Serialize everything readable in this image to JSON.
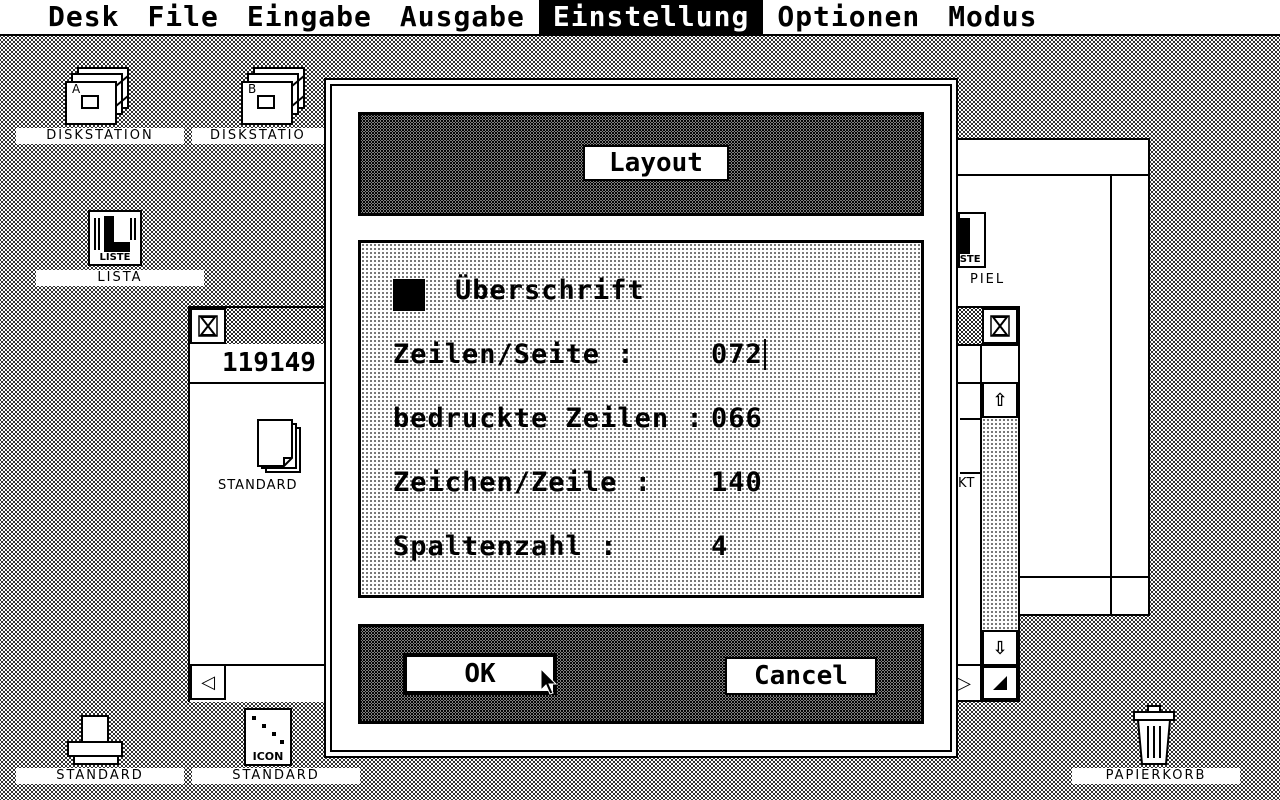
{
  "menubar": {
    "items": [
      {
        "label": "Desk"
      },
      {
        "label": "File"
      },
      {
        "label": "Eingabe"
      },
      {
        "label": "Ausgabe"
      },
      {
        "label": "Einstellung"
      },
      {
        "label": "Optionen"
      },
      {
        "label": "Modus"
      }
    ]
  },
  "desktop": {
    "drive_a_label": "DISKSTATION",
    "drive_b_label": "DISKSTATIO",
    "drive_a_letter": "A",
    "drive_b_letter": "B",
    "lista_label": "LISTA",
    "lista_icon_text": "LISTE",
    "spiel_label": "PIEL",
    "spiel_icon_text": "ISTE",
    "printer_label": "STANDARD",
    "icon_file_label": "STANDARD",
    "icon_file_text": "ICON",
    "trash_label": "PAPIERKORB"
  },
  "left_window": {
    "counter": "119149",
    "file_label": "STANDARD"
  },
  "right_window": {
    "file_label": "KT"
  },
  "dialog": {
    "title": "Layout",
    "checkbox_label": "Überschrift",
    "checkbox_checked": true,
    "rows": [
      {
        "label": "Zeilen/Seite :",
        "value": "072"
      },
      {
        "label": "bedruckte Zeilen :",
        "value": "066"
      },
      {
        "label": "Zeichen/Zeile :",
        "value": "140"
      },
      {
        "label": "Spaltenzahl :",
        "value": "4"
      }
    ],
    "ok_label": "OK",
    "cancel_label": "Cancel"
  }
}
